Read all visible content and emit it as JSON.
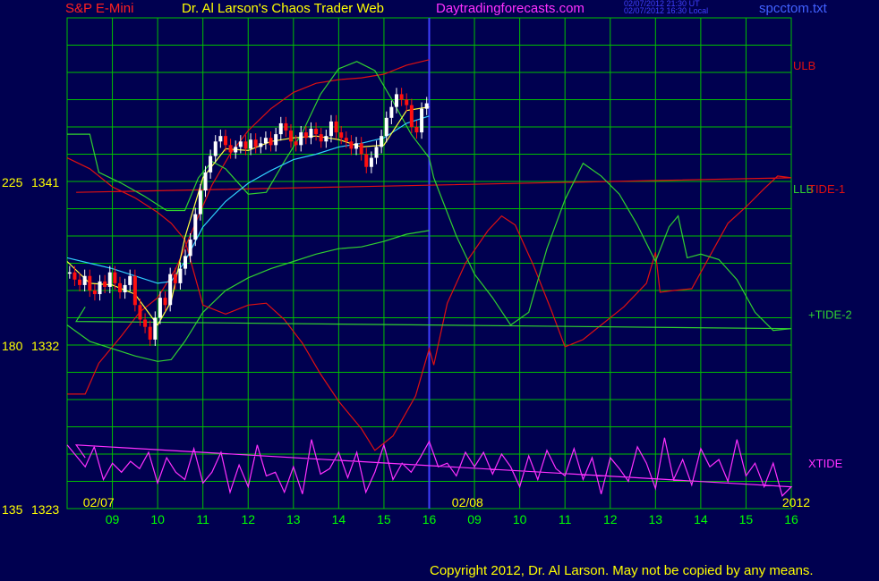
{
  "header": {
    "symbol": "S&P E-Mini",
    "title": "Dr. Al Larson's Chaos Trader Web",
    "site": "Daytradingforecasts.com",
    "ut_time": "02/07/2012 21:30 UT",
    "local_time": "02/07/2012 16:30 Local",
    "file": "spcctom.txt"
  },
  "footer": {
    "copyright": "Copyright 2012, Dr. Al Larson. May not be copied by any means."
  },
  "colors": {
    "background": "#000050",
    "grid": "#00c000",
    "axis_labels": "#00ff00",
    "price_labels": "#ffff00",
    "ulb": "#e01010",
    "llb": "#30d030",
    "tide1": "#e01010",
    "tide2": "#30d030",
    "xtide": "#ff30ff",
    "price_up": "#ffffff",
    "price_down": "#ff1010",
    "moving_average": "#30d0ff",
    "yellow_average": "#ffff40",
    "now_line": "#4040ff"
  },
  "chart_data": {
    "type": "line",
    "title": "S&P E-Mini",
    "ylabel": "",
    "xlabel": "",
    "ylim": [
      1323,
      1350
    ],
    "y_ticks": [
      {
        "value": 1323,
        "label": "1323",
        "alt": "135"
      },
      {
        "value": 1332,
        "label": "1332",
        "alt": "180"
      },
      {
        "value": 1341,
        "label": "1341",
        "alt": "225"
      }
    ],
    "x_hour_ticks": [
      {
        "hour": 9,
        "label": "09"
      },
      {
        "hour": 10,
        "label": "10"
      },
      {
        "hour": 11,
        "label": "11"
      },
      {
        "hour": 12,
        "label": "12"
      },
      {
        "hour": 13,
        "label": "13"
      },
      {
        "hour": 14,
        "label": "14"
      },
      {
        "hour": 15,
        "label": "15"
      },
      {
        "hour": 16,
        "label": "16"
      },
      {
        "hour": 33,
        "label": "09"
      },
      {
        "hour": 34,
        "label": "10"
      },
      {
        "hour": 35,
        "label": "11"
      },
      {
        "hour": 36,
        "label": "12"
      },
      {
        "hour": 37,
        "label": "13"
      },
      {
        "hour": 38,
        "label": "14"
      },
      {
        "hour": 39,
        "label": "15"
      },
      {
        "hour": 40,
        "label": "16"
      }
    ],
    "date_labels": [
      {
        "hour": 8.35,
        "label": "02/07"
      },
      {
        "hour": 32.5,
        "label": "02/08"
      },
      {
        "hour": 39.8,
        "label": "2012"
      }
    ],
    "now_hour": 16.0,
    "series_labels": [
      {
        "name": "ULB",
        "color": "#e01010",
        "y": 1347.4
      },
      {
        "name": "LLB",
        "color": "#30d030",
        "y": 1340.6
      },
      {
        "name": "TIDE-1",
        "color": "#e01010",
        "y": 1340.6
      },
      {
        "name": "+TIDE-2",
        "color": "#30d030",
        "y": 1333.7
      },
      {
        "name": "XTIDE",
        "color": "#ff30ff",
        "y": 1325.5
      }
    ],
    "series": [
      {
        "name": "ULB",
        "color": "#e01010",
        "points": [
          [
            8.0,
            1329.3
          ],
          [
            8.4,
            1329.3
          ],
          [
            8.7,
            1331
          ],
          [
            9.2,
            1332.5
          ],
          [
            9.6,
            1333.8
          ],
          [
            10.0,
            1334.6
          ],
          [
            10.4,
            1336.2
          ],
          [
            10.8,
            1338.5
          ],
          [
            11.2,
            1340.8
          ],
          [
            11.6,
            1342.5
          ],
          [
            12.0,
            1343.8
          ],
          [
            12.5,
            1345.0
          ],
          [
            13.0,
            1345.9
          ],
          [
            13.5,
            1346.4
          ],
          [
            14.0,
            1346.6
          ],
          [
            14.5,
            1346.7
          ],
          [
            15.0,
            1346.9
          ],
          [
            15.5,
            1347.4
          ],
          [
            16.0,
            1347.7
          ]
        ]
      },
      {
        "name": "LLB",
        "color": "#30d030",
        "points": [
          [
            8.0,
            1333.1
          ],
          [
            8.5,
            1332.2
          ],
          [
            9.0,
            1331.8
          ],
          [
            9.5,
            1331.4
          ],
          [
            10.0,
            1331.1
          ],
          [
            10.3,
            1331.2
          ],
          [
            10.6,
            1332.2
          ],
          [
            11.0,
            1333.8
          ],
          [
            11.5,
            1335.0
          ],
          [
            12.0,
            1335.7
          ],
          [
            12.5,
            1336.2
          ],
          [
            13.0,
            1336.6
          ],
          [
            13.5,
            1337.0
          ],
          [
            14.0,
            1337.3
          ],
          [
            14.5,
            1337.4
          ],
          [
            15.0,
            1337.7
          ],
          [
            15.5,
            1338.1
          ],
          [
            16.0,
            1338.3
          ]
        ]
      },
      {
        "name": "TIDE-1",
        "color": "#e01010",
        "points": [
          [
            8.0,
            1342.3
          ],
          [
            8.5,
            1341.7
          ],
          [
            9.0,
            1340.7
          ],
          [
            9.5,
            1340.1
          ],
          [
            10.0,
            1339.3
          ],
          [
            10.3,
            1338.7
          ],
          [
            10.6,
            1337.8
          ],
          [
            10.8,
            1336.0
          ],
          [
            11.0,
            1334.2
          ],
          [
            11.5,
            1333.7
          ],
          [
            12.0,
            1334.2
          ],
          [
            12.4,
            1334.3
          ],
          [
            12.8,
            1333.4
          ],
          [
            13.2,
            1332.1
          ],
          [
            13.6,
            1330.4
          ],
          [
            14.0,
            1328.9
          ],
          [
            14.5,
            1327.4
          ],
          [
            14.8,
            1326.2
          ],
          [
            15.2,
            1327.0
          ],
          [
            15.7,
            1329.2
          ],
          [
            16.0,
            1331.8
          ],
          [
            16.1,
            1330.9
          ],
          [
            16.4,
            1334.3
          ],
          [
            16.8,
            1336.5
          ],
          [
            17.3,
            1338.3
          ],
          [
            17.6,
            1339.1
          ],
          [
            17.9,
            1338.6
          ],
          [
            18.3,
            1336.4
          ],
          [
            18.7,
            1333.9
          ],
          [
            19.0,
            1331.9
          ],
          [
            19.4,
            1332.3
          ],
          [
            19.8,
            1333.1
          ],
          [
            20.3,
            1334.1
          ],
          [
            20.8,
            1335.4
          ],
          [
            21.0,
            1337.1
          ],
          [
            21.1,
            1334.9
          ],
          [
            21.4,
            1335.0
          ],
          [
            21.8,
            1335.1
          ],
          [
            22.2,
            1336.9
          ],
          [
            22.6,
            1338.7
          ],
          [
            23.0,
            1339.6
          ],
          [
            23.4,
            1340.6
          ],
          [
            23.7,
            1341.3
          ],
          [
            24.0,
            1341.2
          ],
          [
            24.2,
            1340.4
          ]
        ]
      },
      {
        "name": "+TIDE-2",
        "color": "#30d030",
        "points": [
          [
            8.0,
            1343.6
          ],
          [
            8.5,
            1343.6
          ],
          [
            8.7,
            1341.5
          ],
          [
            9.2,
            1340.9
          ],
          [
            9.7,
            1340.2
          ],
          [
            10.2,
            1339.4
          ],
          [
            10.6,
            1339.4
          ],
          [
            10.9,
            1341.2
          ],
          [
            11.2,
            1342.1
          ],
          [
            11.5,
            1341.7
          ],
          [
            12.0,
            1340.3
          ],
          [
            12.4,
            1340.4
          ],
          [
            12.8,
            1342.1
          ],
          [
            13.2,
            1343.7
          ],
          [
            13.6,
            1345.8
          ],
          [
            14.0,
            1347.2
          ],
          [
            14.4,
            1347.6
          ],
          [
            14.8,
            1347.1
          ],
          [
            15.2,
            1345.4
          ],
          [
            15.6,
            1343.6
          ],
          [
            16.0,
            1342.3
          ],
          [
            16.1,
            1341.2
          ],
          [
            16.6,
            1338.0
          ],
          [
            17.0,
            1335.9
          ],
          [
            17.4,
            1334.6
          ],
          [
            17.8,
            1333.1
          ],
          [
            18.2,
            1333.8
          ],
          [
            18.6,
            1337.3
          ],
          [
            19.0,
            1340.0
          ],
          [
            19.4,
            1342.0
          ],
          [
            19.8,
            1341.3
          ],
          [
            20.2,
            1340.3
          ],
          [
            20.6,
            1338.6
          ],
          [
            21.0,
            1336.6
          ],
          [
            21.3,
            1338.5
          ],
          [
            21.5,
            1339.1
          ],
          [
            21.7,
            1336.8
          ],
          [
            22.0,
            1337.0
          ],
          [
            22.4,
            1336.7
          ],
          [
            22.8,
            1335.6
          ],
          [
            23.2,
            1333.8
          ],
          [
            23.6,
            1332.8
          ],
          [
            24.0,
            1332.9
          ],
          [
            24.2,
            1333.3
          ],
          [
            24.4,
            1334.1
          ]
        ]
      }
    ],
    "xtide": {
      "name": "XTIDE",
      "color": "#ff30ff",
      "points": [
        [
          8.0,
          1326.5
        ],
        [
          8.2,
          1325.9
        ],
        [
          8.4,
          1325.3
        ],
        [
          8.6,
          1326.4
        ],
        [
          8.8,
          1324.6
        ],
        [
          9.0,
          1325.5
        ],
        [
          9.2,
          1325.0
        ],
        [
          9.4,
          1325.6
        ],
        [
          9.6,
          1325.2
        ],
        [
          9.8,
          1326.1
        ],
        [
          10.0,
          1324.4
        ],
        [
          10.2,
          1325.8
        ],
        [
          10.4,
          1325.0
        ],
        [
          10.6,
          1324.6
        ],
        [
          10.8,
          1326.3
        ],
        [
          11.0,
          1324.4
        ],
        [
          11.2,
          1325.0
        ],
        [
          11.4,
          1326.1
        ],
        [
          11.6,
          1323.9
        ],
        [
          11.8,
          1325.4
        ],
        [
          12.0,
          1324.2
        ],
        [
          12.2,
          1326.5
        ],
        [
          12.4,
          1324.8
        ],
        [
          12.6,
          1325.0
        ],
        [
          12.8,
          1323.9
        ],
        [
          13.0,
          1325.3
        ],
        [
          13.2,
          1323.8
        ],
        [
          13.4,
          1326.8
        ],
        [
          13.6,
          1324.9
        ],
        [
          13.8,
          1325.2
        ],
        [
          14.0,
          1326.1
        ],
        [
          14.2,
          1324.7
        ],
        [
          14.4,
          1326.1
        ],
        [
          14.6,
          1323.9
        ],
        [
          14.8,
          1325.0
        ],
        [
          15.0,
          1326.5
        ],
        [
          15.2,
          1324.6
        ],
        [
          15.4,
          1325.5
        ],
        [
          15.6,
          1325.0
        ],
        [
          15.8,
          1325.8
        ],
        [
          16.0,
          1326.7
        ],
        [
          16.2,
          1325.3
        ],
        [
          16.4,
          1325.5
        ],
        [
          16.6,
          1324.8
        ],
        [
          16.8,
          1326.1
        ],
        [
          17.0,
          1325.3
        ],
        [
          17.2,
          1326.1
        ],
        [
          17.4,
          1324.9
        ],
        [
          17.6,
          1326.0
        ],
        [
          17.8,
          1325.3
        ],
        [
          18.0,
          1324.2
        ],
        [
          18.2,
          1325.9
        ],
        [
          18.4,
          1324.6
        ],
        [
          18.6,
          1326.2
        ],
        [
          18.8,
          1325.2
        ],
        [
          19.0,
          1324.8
        ],
        [
          19.2,
          1326.3
        ],
        [
          19.4,
          1324.6
        ],
        [
          19.6,
          1325.8
        ],
        [
          19.8,
          1323.8
        ],
        [
          20.0,
          1325.8
        ],
        [
          20.2,
          1325.2
        ],
        [
          20.4,
          1324.5
        ],
        [
          20.6,
          1326.4
        ],
        [
          20.8,
          1325.5
        ],
        [
          21.0,
          1324.1
        ],
        [
          21.2,
          1326.9
        ],
        [
          21.4,
          1324.6
        ],
        [
          21.6,
          1325.7
        ],
        [
          21.8,
          1324.3
        ],
        [
          22.0,
          1326.3
        ],
        [
          22.2,
          1325.3
        ],
        [
          22.4,
          1325.7
        ],
        [
          22.6,
          1324.5
        ],
        [
          22.8,
          1326.8
        ],
        [
          23.0,
          1324.8
        ],
        [
          23.2,
          1325.5
        ],
        [
          23.4,
          1324.2
        ],
        [
          23.6,
          1325.5
        ],
        [
          23.8,
          1323.7
        ],
        [
          24.0,
          1324.2
        ],
        [
          24.2,
          1326.5
        ],
        [
          24.4,
          1325.8
        ]
      ]
    },
    "ma_cyan": {
      "name": "cyan average",
      "color": "#30d0ff",
      "points": [
        [
          8.0,
          1336.8
        ],
        [
          8.5,
          1336.5
        ],
        [
          9.0,
          1336.2
        ],
        [
          9.5,
          1335.8
        ],
        [
          10.0,
          1335.4
        ],
        [
          10.3,
          1335.5
        ],
        [
          10.6,
          1336.6
        ],
        [
          11.0,
          1338.5
        ],
        [
          11.5,
          1339.9
        ],
        [
          12.0,
          1340.9
        ],
        [
          12.5,
          1341.6
        ],
        [
          13.0,
          1342.2
        ],
        [
          13.5,
          1342.5
        ],
        [
          14.0,
          1342.9
        ],
        [
          14.5,
          1343.1
        ],
        [
          15.0,
          1343.4
        ],
        [
          15.5,
          1344.2
        ],
        [
          16.0,
          1344.6
        ]
      ]
    },
    "ma_yellow": {
      "name": "yellow average",
      "color": "#ffff40",
      "points": [
        [
          8.0,
          1336.6
        ],
        [
          8.5,
          1335.4
        ],
        [
          9.0,
          1335.3
        ],
        [
          9.5,
          1334.8
        ],
        [
          10.0,
          1333.1
        ],
        [
          10.3,
          1334.4
        ],
        [
          10.6,
          1337.9
        ],
        [
          11.0,
          1341.2
        ],
        [
          11.5,
          1342.8
        ],
        [
          12.0,
          1342.7
        ],
        [
          12.5,
          1343.2
        ],
        [
          13.0,
          1343.4
        ],
        [
          13.5,
          1343.5
        ],
        [
          14.0,
          1343.3
        ],
        [
          14.5,
          1342.9
        ],
        [
          15.0,
          1343.0
        ],
        [
          15.5,
          1344.9
        ],
        [
          16.0,
          1345.1
        ]
      ]
    },
    "price_closes": [
      1336.0,
      1335.6,
      1335.3,
      1335.8,
      1335.0,
      1334.8,
      1335.5,
      1335.2,
      1336.0,
      1335.4,
      1334.9,
      1335.3,
      1335.8,
      1334.2,
      1333.4,
      1333.0,
      1332.3,
      1333.5,
      1334.6,
      1334.2,
      1335.9,
      1335.4,
      1336.2,
      1336.9,
      1337.8,
      1339.2,
      1340.5,
      1341.5,
      1342.4,
      1343.2,
      1343.5,
      1343.0,
      1342.6,
      1342.9,
      1343.2,
      1342.8,
      1343.3,
      1342.9,
      1343.1,
      1343.4,
      1343.0,
      1343.6,
      1344.2,
      1343.8,
      1343.2,
      1343.0,
      1343.7,
      1343.4,
      1343.9,
      1343.6,
      1343.2,
      1343.5,
      1344.3,
      1343.7,
      1343.4,
      1343.2,
      1342.8,
      1343.1,
      1342.5,
      1341.8,
      1342.3,
      1342.9,
      1343.5,
      1344.5,
      1345.1,
      1345.8,
      1345.5,
      1345.2,
      1344.0,
      1343.7,
      1345.0,
      1345.3
    ]
  }
}
